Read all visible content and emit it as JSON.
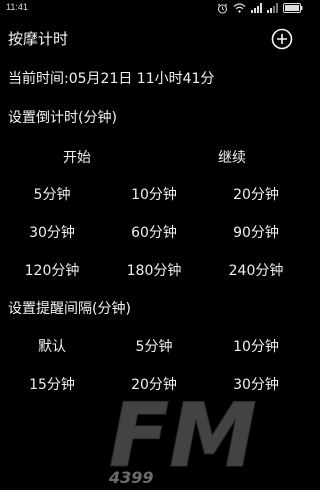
{
  "status_bar": {
    "time": "11:41",
    "icons": [
      "alarm-icon",
      "wifi-icon",
      "signal-icon",
      "signal-icon",
      "battery-icon"
    ]
  },
  "app_bar": {
    "title": "按摩计时",
    "add_icon": "plus-circle-icon"
  },
  "current_time": "当前时间:05月21日 11小时41分",
  "countdown": {
    "section_title": "设置倒计时(分钟)",
    "actions": [
      "开始",
      "继续"
    ],
    "options": [
      [
        "5分钟",
        "10分钟",
        "20分钟"
      ],
      [
        "30分钟",
        "60分钟",
        "90分钟"
      ],
      [
        "120分钟",
        "180分钟",
        "240分钟"
      ]
    ]
  },
  "reminder": {
    "section_title": "设置提醒间隔(分钟)",
    "options": [
      [
        "默认",
        "5分钟",
        "10分钟"
      ],
      [
        "15分钟",
        "20分钟",
        "30分钟"
      ]
    ]
  },
  "watermark": {
    "logo_text": "FM",
    "logo_sub": "4399"
  }
}
